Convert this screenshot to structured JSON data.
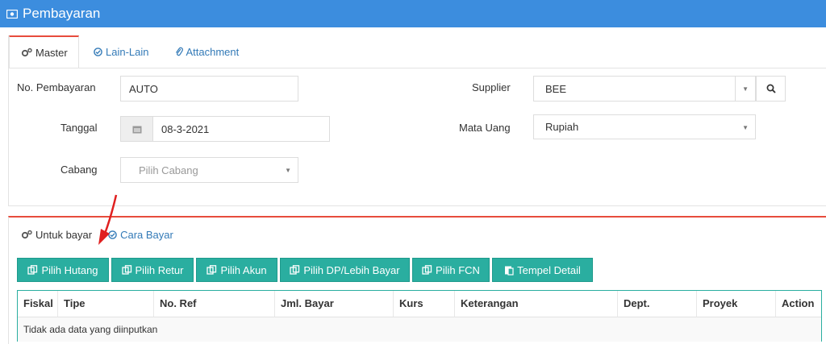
{
  "window": {
    "title": "Pembayaran",
    "icon": "money-icon"
  },
  "top_tabs": [
    {
      "label": "Master",
      "icon": "cogs-icon",
      "active": true
    },
    {
      "label": "Lain-Lain",
      "icon": "check-circle-icon",
      "active": false
    },
    {
      "label": "Attachment",
      "icon": "paperclip-icon",
      "active": false
    }
  ],
  "form": {
    "no_pembayaran_label": "No. Pembayaran",
    "no_pembayaran_value": "AUTO",
    "tanggal_label": "Tanggal",
    "tanggal_value": "08-3-2021",
    "cabang_label": "Cabang",
    "cabang_placeholder": "Pilih Cabang",
    "supplier_label": "Supplier",
    "supplier_value": "BEE",
    "mata_uang_label": "Mata Uang",
    "mata_uang_value": "Rupiah"
  },
  "detail_tabs": [
    {
      "label": "Untuk bayar",
      "icon": "cogs-icon",
      "active": true
    },
    {
      "label": "Cara Bayar",
      "icon": "check-circle-icon",
      "active": false
    }
  ],
  "buttons": {
    "pilih_hutang": "Pilih Hutang",
    "pilih_retur": "Pilih Retur",
    "pilih_akun": "Pilih Akun",
    "pilih_dp": "Pilih DP/Lebih Bayar",
    "pilih_fcn": "Pilih FCN",
    "tempel_detail": "Tempel Detail"
  },
  "table": {
    "columns": [
      "Fiskal",
      "Tipe",
      "No. Ref",
      "Jml. Bayar",
      "Kurs",
      "Keterangan",
      "Dept.",
      "Proyek",
      "Action"
    ],
    "empty_text": "Tidak ada data yang diinputkan"
  },
  "colors": {
    "header": "#3c8dde",
    "button": "#2aaea0",
    "accent_red": "#e74c3c",
    "link": "#337ab7"
  }
}
